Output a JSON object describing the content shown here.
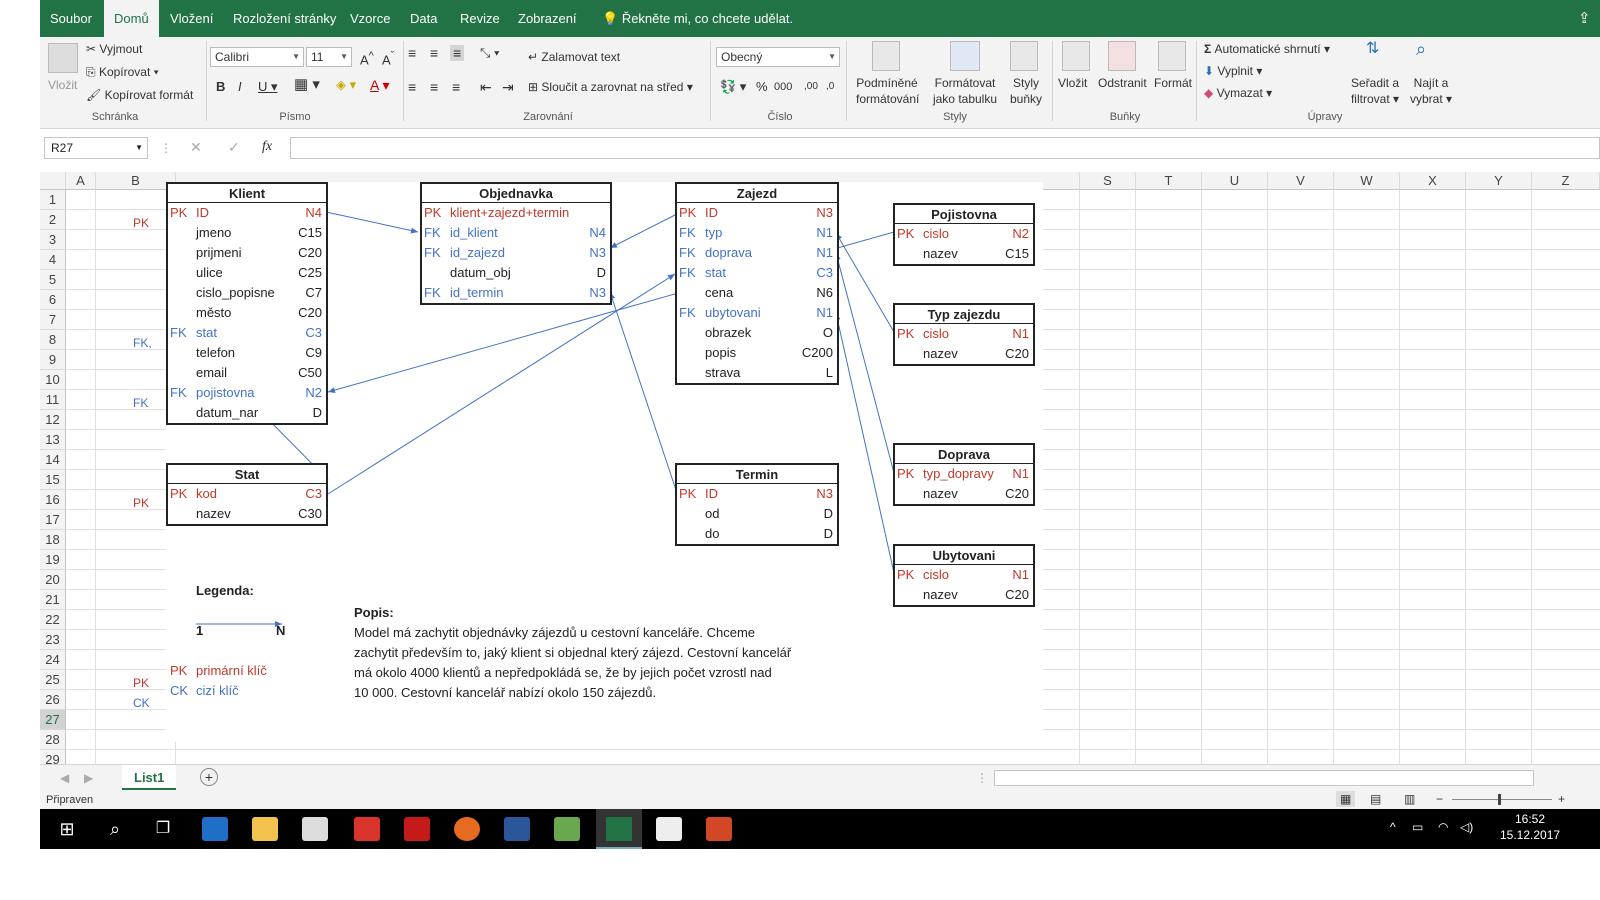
{
  "ribbon_tabs": [
    "Soubor",
    "Domů",
    "Vložení",
    "Rozložení stránky",
    "Vzorce",
    "Data",
    "Revize",
    "Zobrazení"
  ],
  "tell_me": "Řekněte mi, co chcete udělat.",
  "clipboard": {
    "paste": "Vložit",
    "cut": "Vyjmout",
    "copy": "Kopírovat",
    "format_painter": "Kopírovat formát",
    "group": "Schránka"
  },
  "font": {
    "name": "Calibri",
    "size": "11",
    "group": "Písmo"
  },
  "alignment": {
    "wrap": "Zalamovat text",
    "merge": "Sloučit a zarovnat na střed",
    "group": "Zarovnání"
  },
  "number": {
    "format": "Obecný",
    "group": "Číslo"
  },
  "styles": {
    "conditional_1": "Podmíněné",
    "conditional_2": "formátování",
    "table_1": "Formátovat",
    "table_2": "jako tabulku",
    "cell_1": "Styly",
    "cell_2": "buňky",
    "group": "Styly"
  },
  "cells": {
    "insert": "Vložit",
    "delete": "Odstranit",
    "format": "Formát",
    "group": "Buňky"
  },
  "editing": {
    "autosum": "Automatické shrnutí",
    "fill": "Vyplnit",
    "clear": "Vymazat",
    "sort_1": "Seřadit a",
    "sort_2": "filtrovat",
    "find_1": "Najít a",
    "find_2": "vybrat",
    "group": "Úpravy"
  },
  "name_box": "R27",
  "fx": "fx",
  "columns": [
    "A",
    "B",
    "S",
    "T",
    "U",
    "V",
    "W",
    "X",
    "Y",
    "Z"
  ],
  "rows": [
    "1",
    "2",
    "3",
    "4",
    "5",
    "6",
    "7",
    "8",
    "9",
    "10",
    "11",
    "12",
    "13",
    "14",
    "15",
    "16",
    "17",
    "18",
    "19",
    "20",
    "21",
    "22",
    "23",
    "24",
    "25",
    "26",
    "27",
    "28",
    "29"
  ],
  "side_labels": {
    "pk3": "PK",
    "fk9": "FK,",
    "fk12": "FK",
    "pk17": "PK",
    "pk26": "PK",
    "ck27": "CK"
  },
  "klient": {
    "title": "Klient",
    "rows": [
      {
        "k": "PK",
        "n": "ID",
        "t": "N4"
      },
      {
        "k": "",
        "n": "jmeno",
        "t": "C15"
      },
      {
        "k": "",
        "n": "prijmeni",
        "t": "C20"
      },
      {
        "k": "",
        "n": "ulice",
        "t": "C25"
      },
      {
        "k": "",
        "n": "cislo_popisne",
        "t": "C7"
      },
      {
        "k": "",
        "n": "město",
        "t": "C20"
      },
      {
        "k": "FK",
        "n": "stat",
        "t": "C3"
      },
      {
        "k": "",
        "n": "telefon",
        "t": "C9"
      },
      {
        "k": "",
        "n": "email",
        "t": "C50"
      },
      {
        "k": "FK",
        "n": "pojistovna",
        "t": "N2"
      },
      {
        "k": "",
        "n": "datum_nar",
        "t": "D"
      }
    ]
  },
  "stat": {
    "title": "Stat",
    "rows": [
      {
        "k": "PK",
        "n": "kod",
        "t": "C3"
      },
      {
        "k": "",
        "n": "nazev",
        "t": "C30"
      }
    ]
  },
  "objednavka": {
    "title": "Objednavka",
    "rows": [
      {
        "k": "PK",
        "n": "klient+zajezd+termin",
        "t": ""
      },
      {
        "k": "FK",
        "n": "id_klient",
        "t": "N4"
      },
      {
        "k": "FK",
        "n": "id_zajezd",
        "t": "N3"
      },
      {
        "k": "",
        "n": "datum_obj",
        "t": "D"
      },
      {
        "k": "FK",
        "n": "id_termin",
        "t": "N3"
      }
    ]
  },
  "zajezd": {
    "title": "Zajezd",
    "rows": [
      {
        "k": "PK",
        "n": "ID",
        "t": "N3"
      },
      {
        "k": "FK",
        "n": "typ",
        "t": "N1"
      },
      {
        "k": "FK",
        "n": "doprava",
        "t": "N1"
      },
      {
        "k": "FK",
        "n": "stat",
        "t": "C3"
      },
      {
        "k": "",
        "n": "cena",
        "t": "N6"
      },
      {
        "k": "FK",
        "n": "ubytovani",
        "t": "N1"
      },
      {
        "k": "",
        "n": "obrazek",
        "t": "O"
      },
      {
        "k": "",
        "n": "popis",
        "t": "C200"
      },
      {
        "k": "",
        "n": "strava",
        "t": "L"
      }
    ]
  },
  "termin": {
    "title": "Termin",
    "rows": [
      {
        "k": "PK",
        "n": "ID",
        "t": "N3"
      },
      {
        "k": "",
        "n": "od",
        "t": "D"
      },
      {
        "k": "",
        "n": "do",
        "t": "D"
      }
    ]
  },
  "pojistovna": {
    "title": "Pojistovna",
    "rows": [
      {
        "k": "PK",
        "n": "cislo",
        "t": "N2"
      },
      {
        "k": "",
        "n": "nazev",
        "t": "C15"
      }
    ]
  },
  "typ_zajezdu": {
    "title": "Typ zajezdu",
    "rows": [
      {
        "k": "PK",
        "n": "cislo",
        "t": "N1"
      },
      {
        "k": "",
        "n": "nazev",
        "t": "C20"
      }
    ]
  },
  "doprava": {
    "title": "Doprava",
    "rows": [
      {
        "k": "PK",
        "n": "typ_dopravy",
        "t": "N1"
      },
      {
        "k": "",
        "n": "nazev",
        "t": "C20"
      }
    ]
  },
  "ubytovani": {
    "title": "Ubytovani",
    "rows": [
      {
        "k": "PK",
        "n": "cislo",
        "t": "N1"
      },
      {
        "k": "",
        "n": "nazev",
        "t": "C20"
      }
    ]
  },
  "legend": {
    "title": "Legenda:",
    "one": "1",
    "n": "N",
    "pk": "PK",
    "pk_text": "primární klíč",
    "ck": "CK",
    "ck_text": "cizí klíč"
  },
  "popis": {
    "title": "Popis:",
    "lines": [
      "Model má zachytit objednávky zájezdů  u cestovní kanceláře. Chceme",
      "zachytit především to, jaký klient si objednal který zájezd. Cestovní kancelář",
      "má okolo 4000 klientů a nepředpokládá se, že by jejich počet vzrostl nad",
      "10 000. Cestovní kancelář nabízí okolo 150 zájezdů."
    ]
  },
  "sheet_tab": "List1",
  "status": "Připraven",
  "clock": {
    "time": "16:52",
    "date": "15.12.2017"
  },
  "colors": {
    "excel_green": "#217346",
    "pk_red": "#c0392b",
    "fk_blue": "#4472c4"
  }
}
